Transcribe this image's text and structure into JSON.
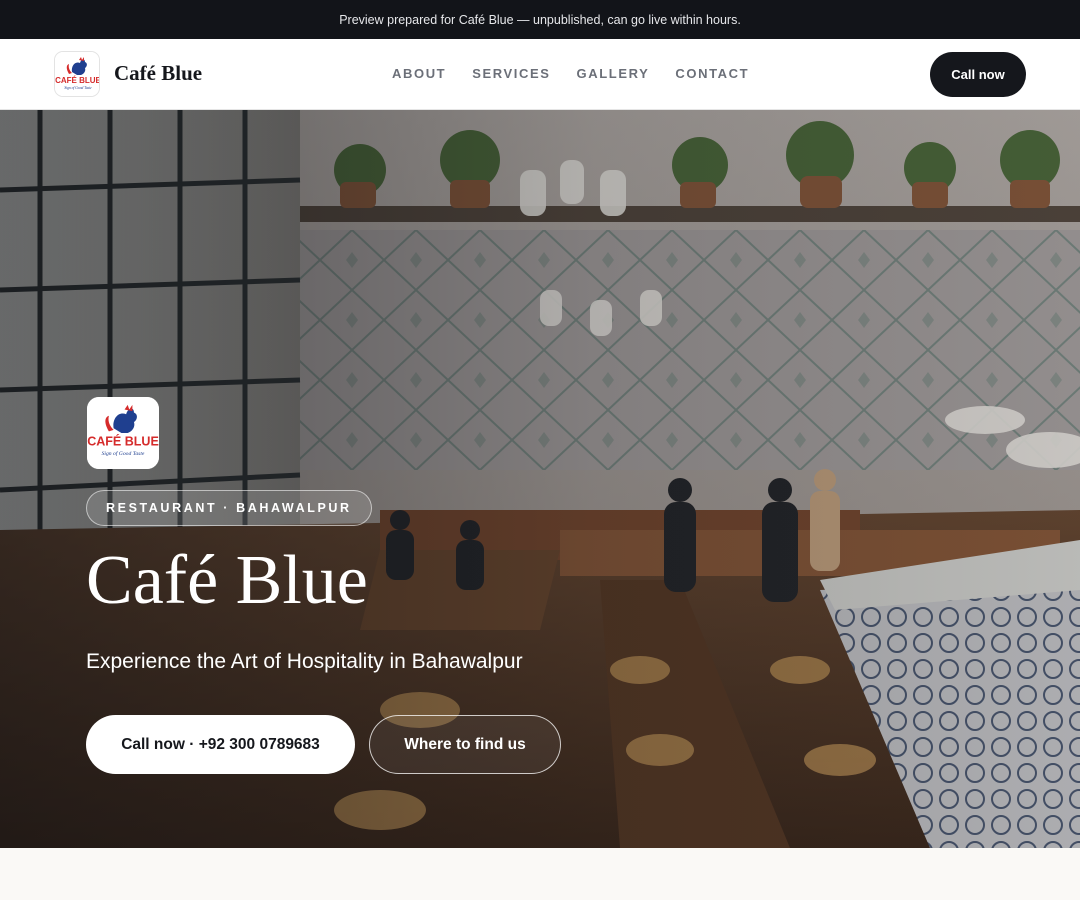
{
  "preview_banner": "Preview prepared for Café Blue — unpublished, can go live within hours.",
  "nav": {
    "brand": "Café Blue",
    "links": [
      "ABOUT",
      "SERVICES",
      "GALLERY",
      "CONTACT"
    ],
    "cta": "Call now"
  },
  "logo": {
    "wordmark": "CAFÉ BLUE",
    "slogan": "Sign of Good Taste",
    "icon": "rooster-icon"
  },
  "hero": {
    "eyebrow": "RESTAURANT · BAHAWALPUR",
    "title": "Café Blue",
    "tagline": "Experience the Art of Hospitality in Bahawalpur",
    "primary_cta": "Call now · +92 300 0789683",
    "secondary_cta": "Where to find us",
    "background": "restaurant-interior-photo"
  },
  "colors": {
    "dark": "#15171c",
    "logo_red": "#d52b2b",
    "logo_blue": "#1f3f8f"
  }
}
